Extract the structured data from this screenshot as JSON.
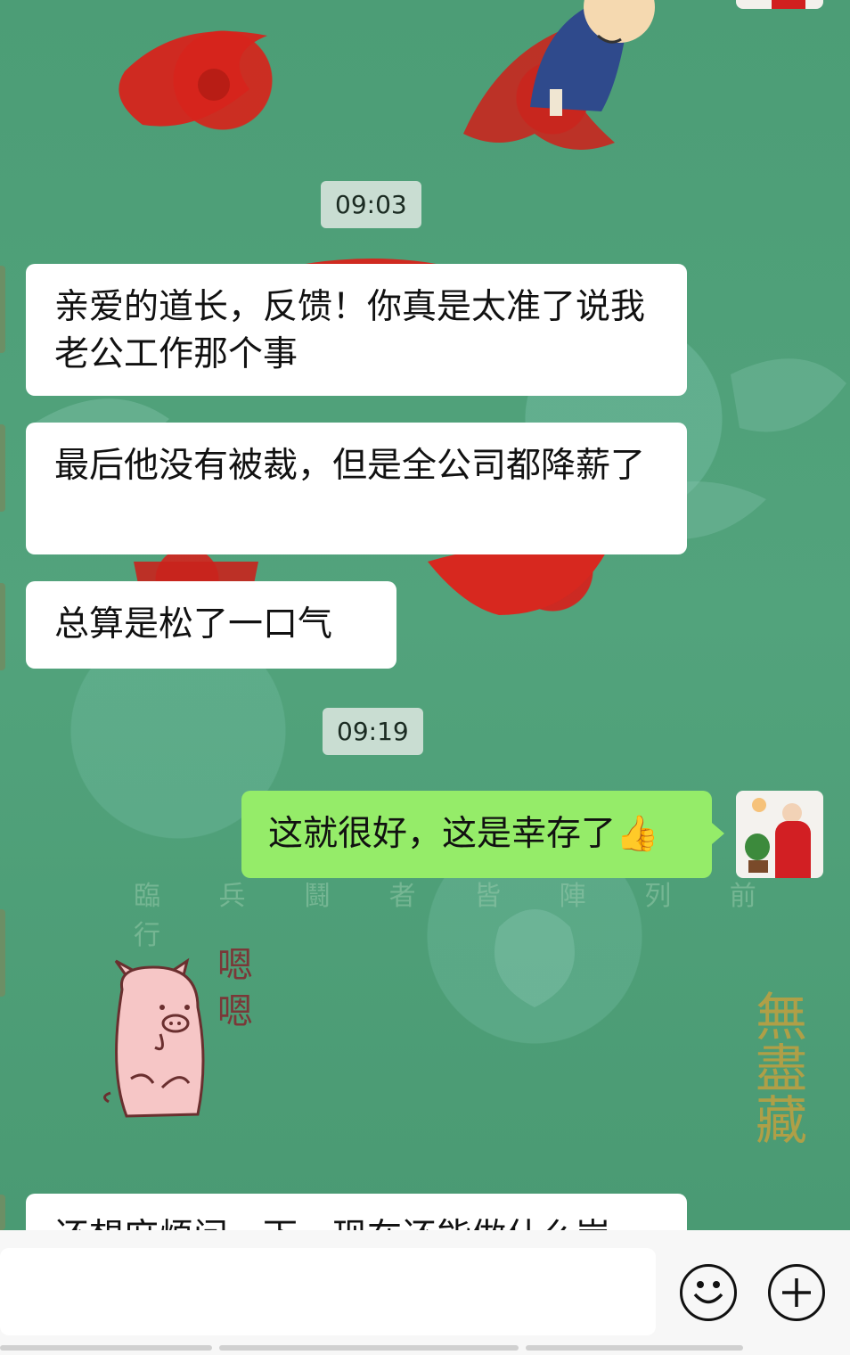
{
  "messages": {
    "time_1": "09:03",
    "msg_1": "亲爱的道长，反馈！你真是太准了说我老公工作那个事",
    "msg_2": "最后他没有被裁，但是全公司都降薪了",
    "msg_3": "总算是松了一口气",
    "time_2": "09:19",
    "msg_4": "这就很好，这是幸存了",
    "msg_4_emoji": "👍",
    "sticker_text_1": "嗯",
    "sticker_text_2": "嗯",
    "msg_5_partial": "还想麻烦问一下，现在还能做什么岗"
  },
  "background": {
    "banner_text": "臨 兵 鬪 者 皆 陣 列 前 行",
    "gold_text": "無盡藏"
  },
  "icons": {
    "emoji_button": "smiley-face-icon",
    "more_button": "plus-icon",
    "thumbs_up": "thumbs-up-emoji"
  },
  "colors": {
    "outgoing_bubble": "#95ec69",
    "incoming_bubble": "#ffffff",
    "timestamp_bg": "#c9ddd2",
    "chat_bg": "#4f9f78"
  }
}
